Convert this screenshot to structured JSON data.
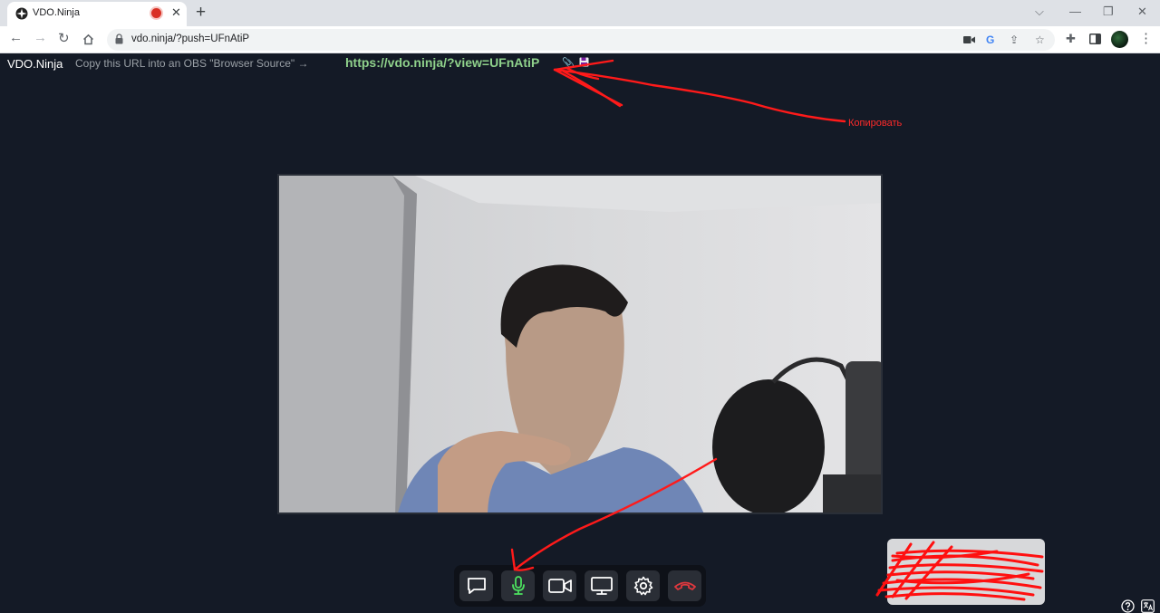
{
  "browser": {
    "tab_title": "VDO.Ninja",
    "new_tab": "+",
    "url": "vdo.ninja/?push=UFnAtiP"
  },
  "header": {
    "brand": "VDO.Ninja",
    "instruction": "Copy this URL into an OBS \"Browser Source\" →",
    "view_link": "https://vdo.ninja/?view=UFnAtiP"
  },
  "annotation": {
    "label": "Копировать",
    "color": "#ff2a2a"
  },
  "controls": [
    {
      "name": "chat-button",
      "icon": "chat-icon"
    },
    {
      "name": "mic-button",
      "icon": "mic-icon",
      "state": "on",
      "color": "#4ce05f"
    },
    {
      "name": "camera-button",
      "icon": "camera-icon"
    },
    {
      "name": "screenshare-button",
      "icon": "monitor-icon"
    },
    {
      "name": "settings-button",
      "icon": "gear-icon"
    },
    {
      "name": "hangup-button",
      "icon": "hangup-icon",
      "color": "#e0383e"
    }
  ],
  "colors": {
    "background": "#141a26",
    "link": "#8fd18b",
    "accent_green": "#4ce05f",
    "hangup_red": "#e0383e"
  }
}
